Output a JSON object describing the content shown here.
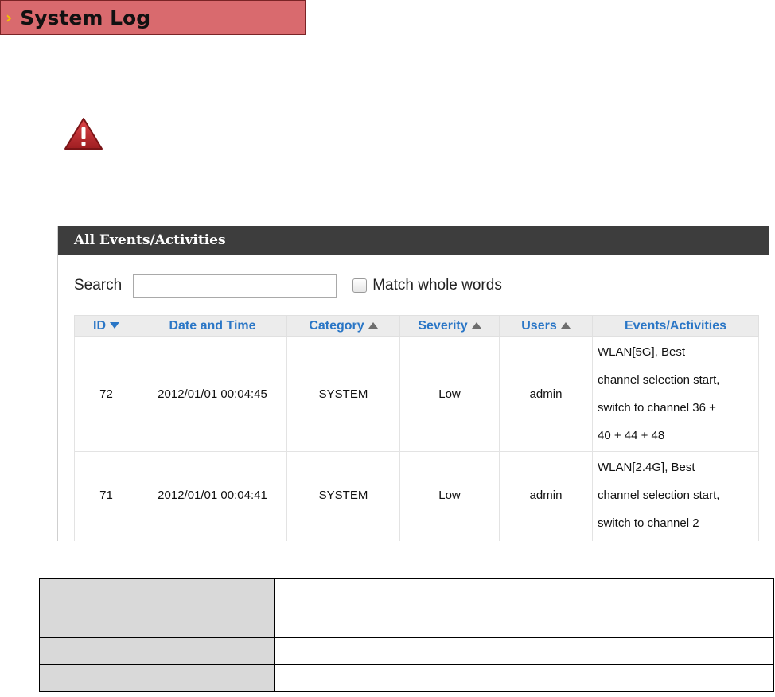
{
  "banner": {
    "title": "System Log"
  },
  "panel": {
    "title": "All Events/Activities"
  },
  "search": {
    "label": "Search",
    "value": "",
    "placeholder": "",
    "match_whole_words_label": "Match whole words",
    "match_whole_words_checked": false
  },
  "table": {
    "columns": [
      {
        "label": "ID",
        "sort": "desc"
      },
      {
        "label": "Date and Time",
        "sort": "none"
      },
      {
        "label": "Category",
        "sort": "asc"
      },
      {
        "label": "Severity",
        "sort": "asc"
      },
      {
        "label": "Users",
        "sort": "asc"
      },
      {
        "label": "Events/Activities",
        "sort": "none"
      }
    ],
    "rows": [
      {
        "id": "72",
        "datetime": "2012/01/01 00:04:45",
        "category": "SYSTEM",
        "severity": "Low",
        "user": "admin",
        "event_lines": [
          "WLAN[5G], Best",
          "channel selection start,",
          "switch to channel 36 +",
          "40 + 44 + 48"
        ]
      },
      {
        "id": "71",
        "datetime": "2012/01/01 00:04:41",
        "category": "SYSTEM",
        "severity": "Low",
        "user": "admin",
        "event_lines": [
          "WLAN[2.4G], Best",
          "channel selection start,",
          "switch to channel 2"
        ]
      }
    ]
  },
  "colors": {
    "banner_bg": "#d96a6e",
    "chevron": "#f2c200",
    "panel_header_bg": "#3d3d3d",
    "column_header_text": "#2a76c6",
    "warning_red": "#c0282d"
  },
  "icons": {
    "banner": "chevron-right-icon",
    "warning": "warning-triangle-icon",
    "sort_desc": "sort-desc-icon",
    "sort_asc": "sort-asc-icon",
    "checkbox": "checkbox-icon"
  }
}
